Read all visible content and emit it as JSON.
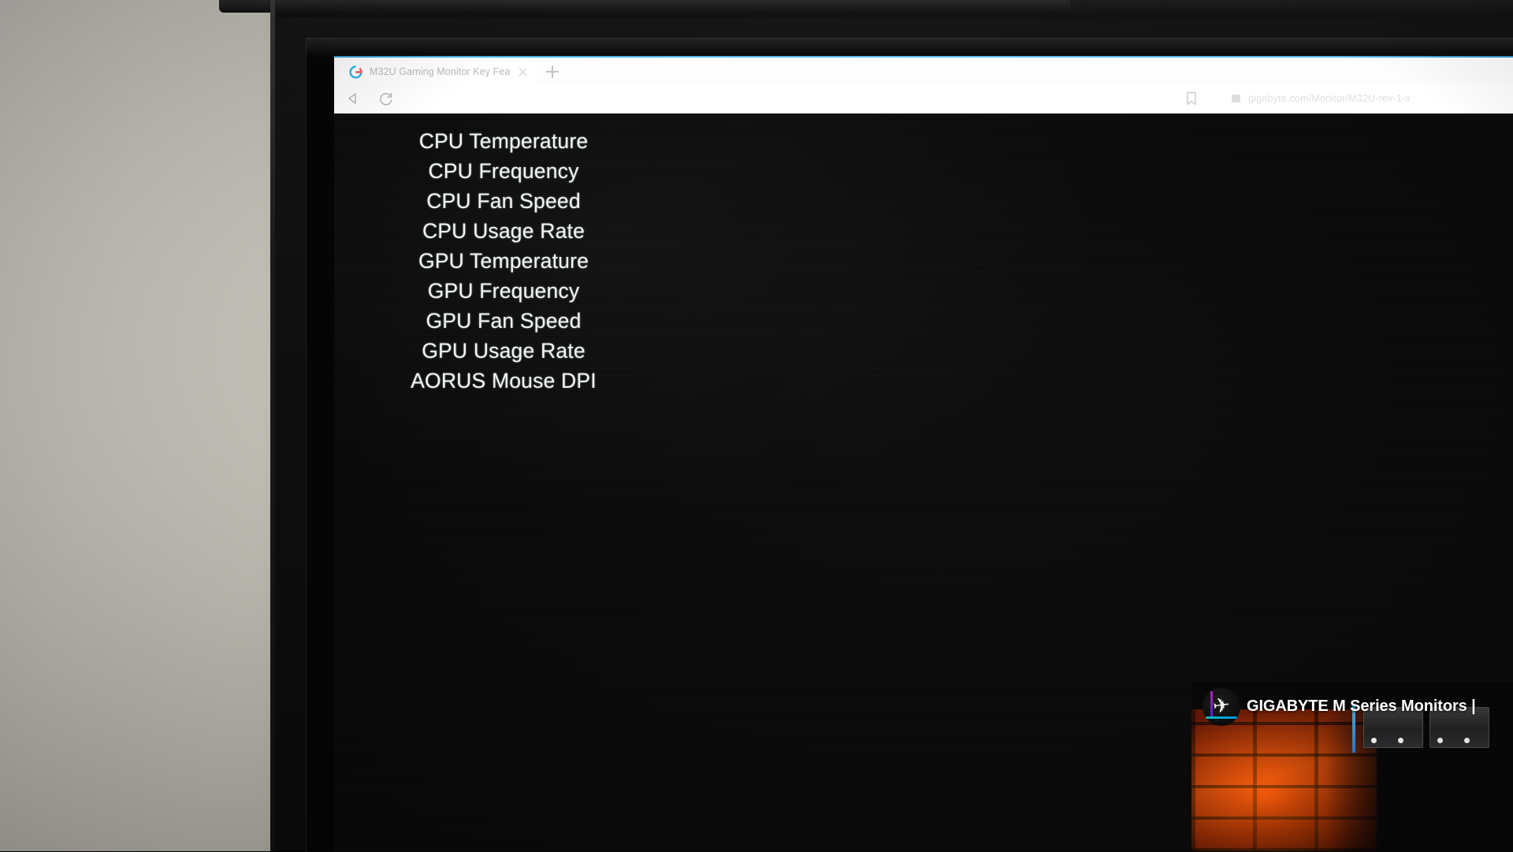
{
  "browser": {
    "tab": {
      "title": "M32U Gaming Monitor Key Fea",
      "favicon_name": "gigabyte-g-favicon",
      "close_label": "×"
    },
    "new_tab_label": "+",
    "toolbar": {
      "back_icon": "back-arrow-icon",
      "reload_icon": "reload-icon",
      "bookmark_icon": "bookmark-icon",
      "url": "gigabyte.com/Monitor/M32U-rev-1-x"
    }
  },
  "page": {
    "feature_list": [
      {
        "label": "CPU Temperature"
      },
      {
        "label": "CPU Frequency"
      },
      {
        "label": "CPU Fan Speed"
      },
      {
        "label": "CPU Usage Rate"
      },
      {
        "label": "GPU Temperature"
      },
      {
        "label": "GPU Frequency"
      },
      {
        "label": "GPU Fan Speed"
      },
      {
        "label": "GPU Usage Rate"
      },
      {
        "label": "AORUS Mouse DPI"
      }
    ],
    "video_card": {
      "title": "GIGABYTE M Series Monitors |",
      "logo_name": "aorus-falcon-logo",
      "logo_glyph": "✈"
    }
  },
  "colors": {
    "screen_background": "#080808",
    "text_primary": "#f4f6f4",
    "chrome_accent": "#4bb8ef",
    "brick_accent": "#d2481b",
    "aorus_teal": "#00d6c8"
  }
}
